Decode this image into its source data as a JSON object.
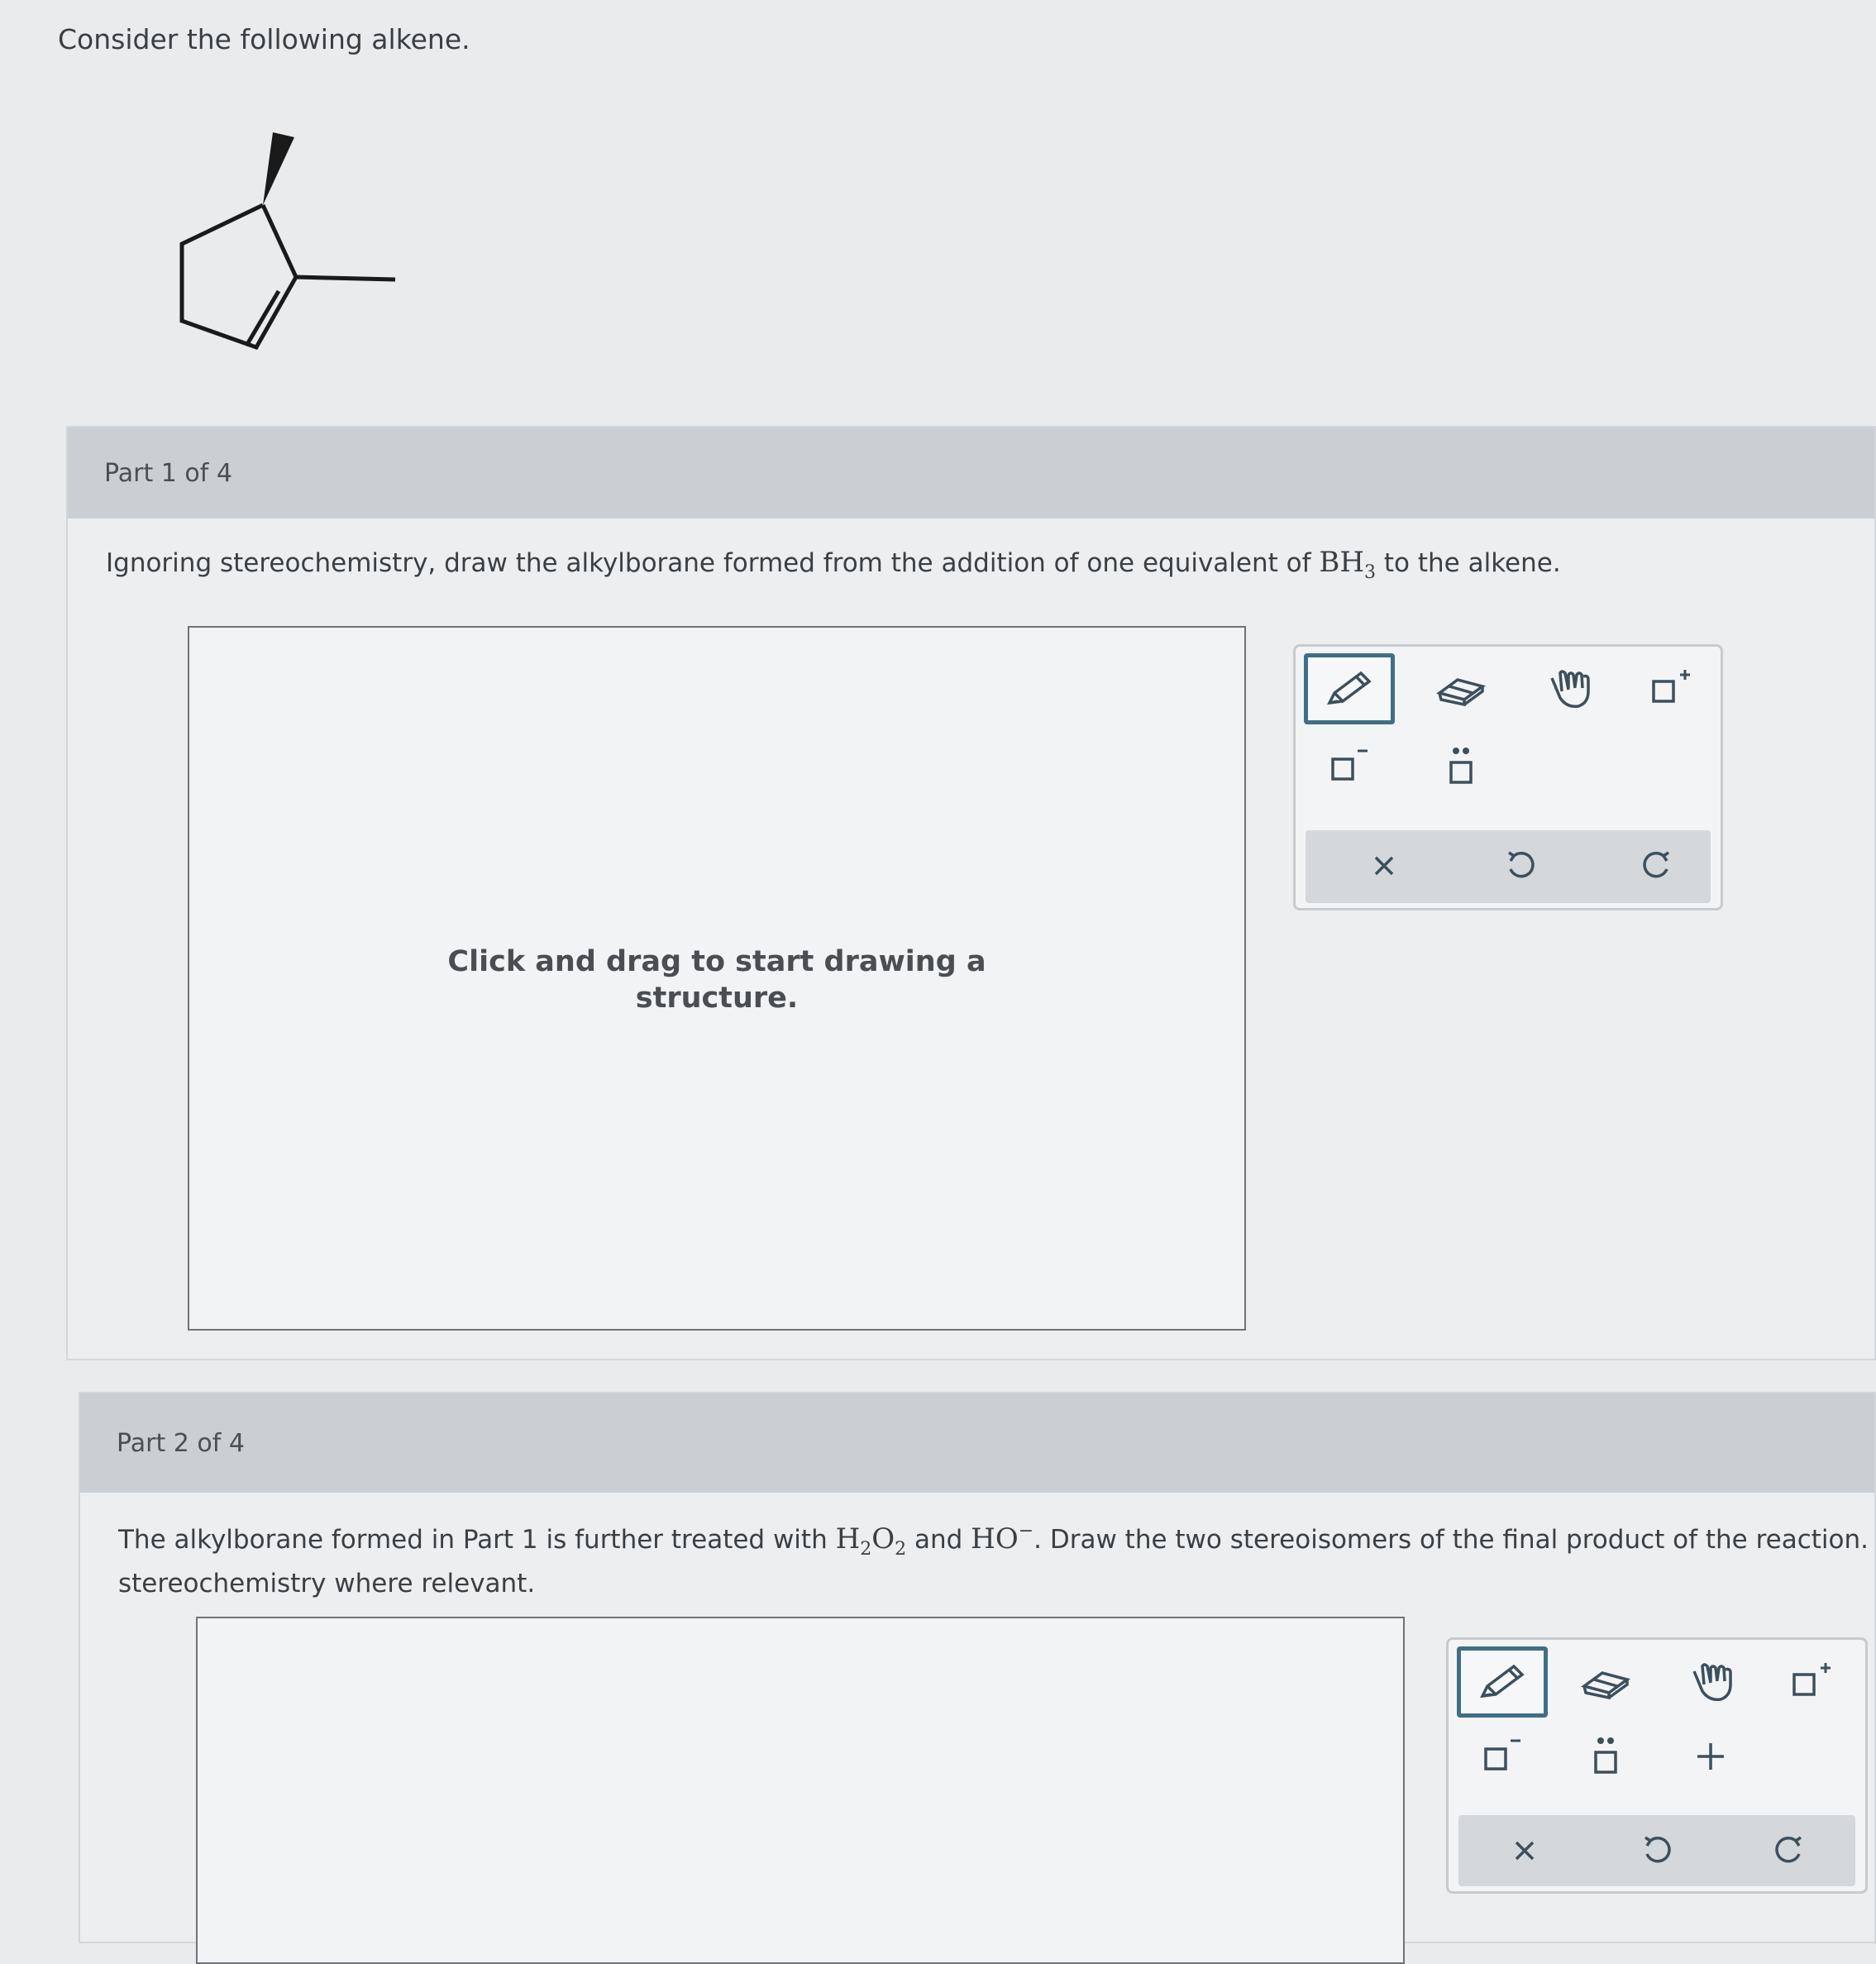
{
  "intro": {
    "text": "Consider the following alkene."
  },
  "part1": {
    "label": "Part 1 of 4",
    "question": {
      "before": "Ignoring stereochemistry, draw the alkylborane formed from the addition of one equivalent of",
      "reagent": "BH",
      "reagent_sub": "3",
      "after": "to the alkene."
    },
    "canvas_hint": "Click and drag to start drawing a structure."
  },
  "part2": {
    "label": "Part 2 of 4",
    "question": {
      "t1": "The alkylborane formed in Part 1 is further treated with",
      "h2o2_h": "H",
      "h2o2_sub1": "2",
      "h2o2_o": "O",
      "h2o2_sub2": "2",
      "t2": "and",
      "ho": "HO",
      "ho_sup": "−",
      "t3": ". Draw the two stereoisomers of the final product of the reaction. Incluc",
      "line2": "stereochemistry where relevant."
    }
  },
  "toolbar": {
    "tools": [
      "pencil-icon",
      "eraser-icon",
      "hand-icon",
      "plus-charge-icon",
      "minus-charge-icon",
      "lone-pair-icon"
    ],
    "extra_tools": [
      "plus-icon"
    ],
    "actions": [
      "clear-icon",
      "undo-icon",
      "redo-icon"
    ]
  }
}
